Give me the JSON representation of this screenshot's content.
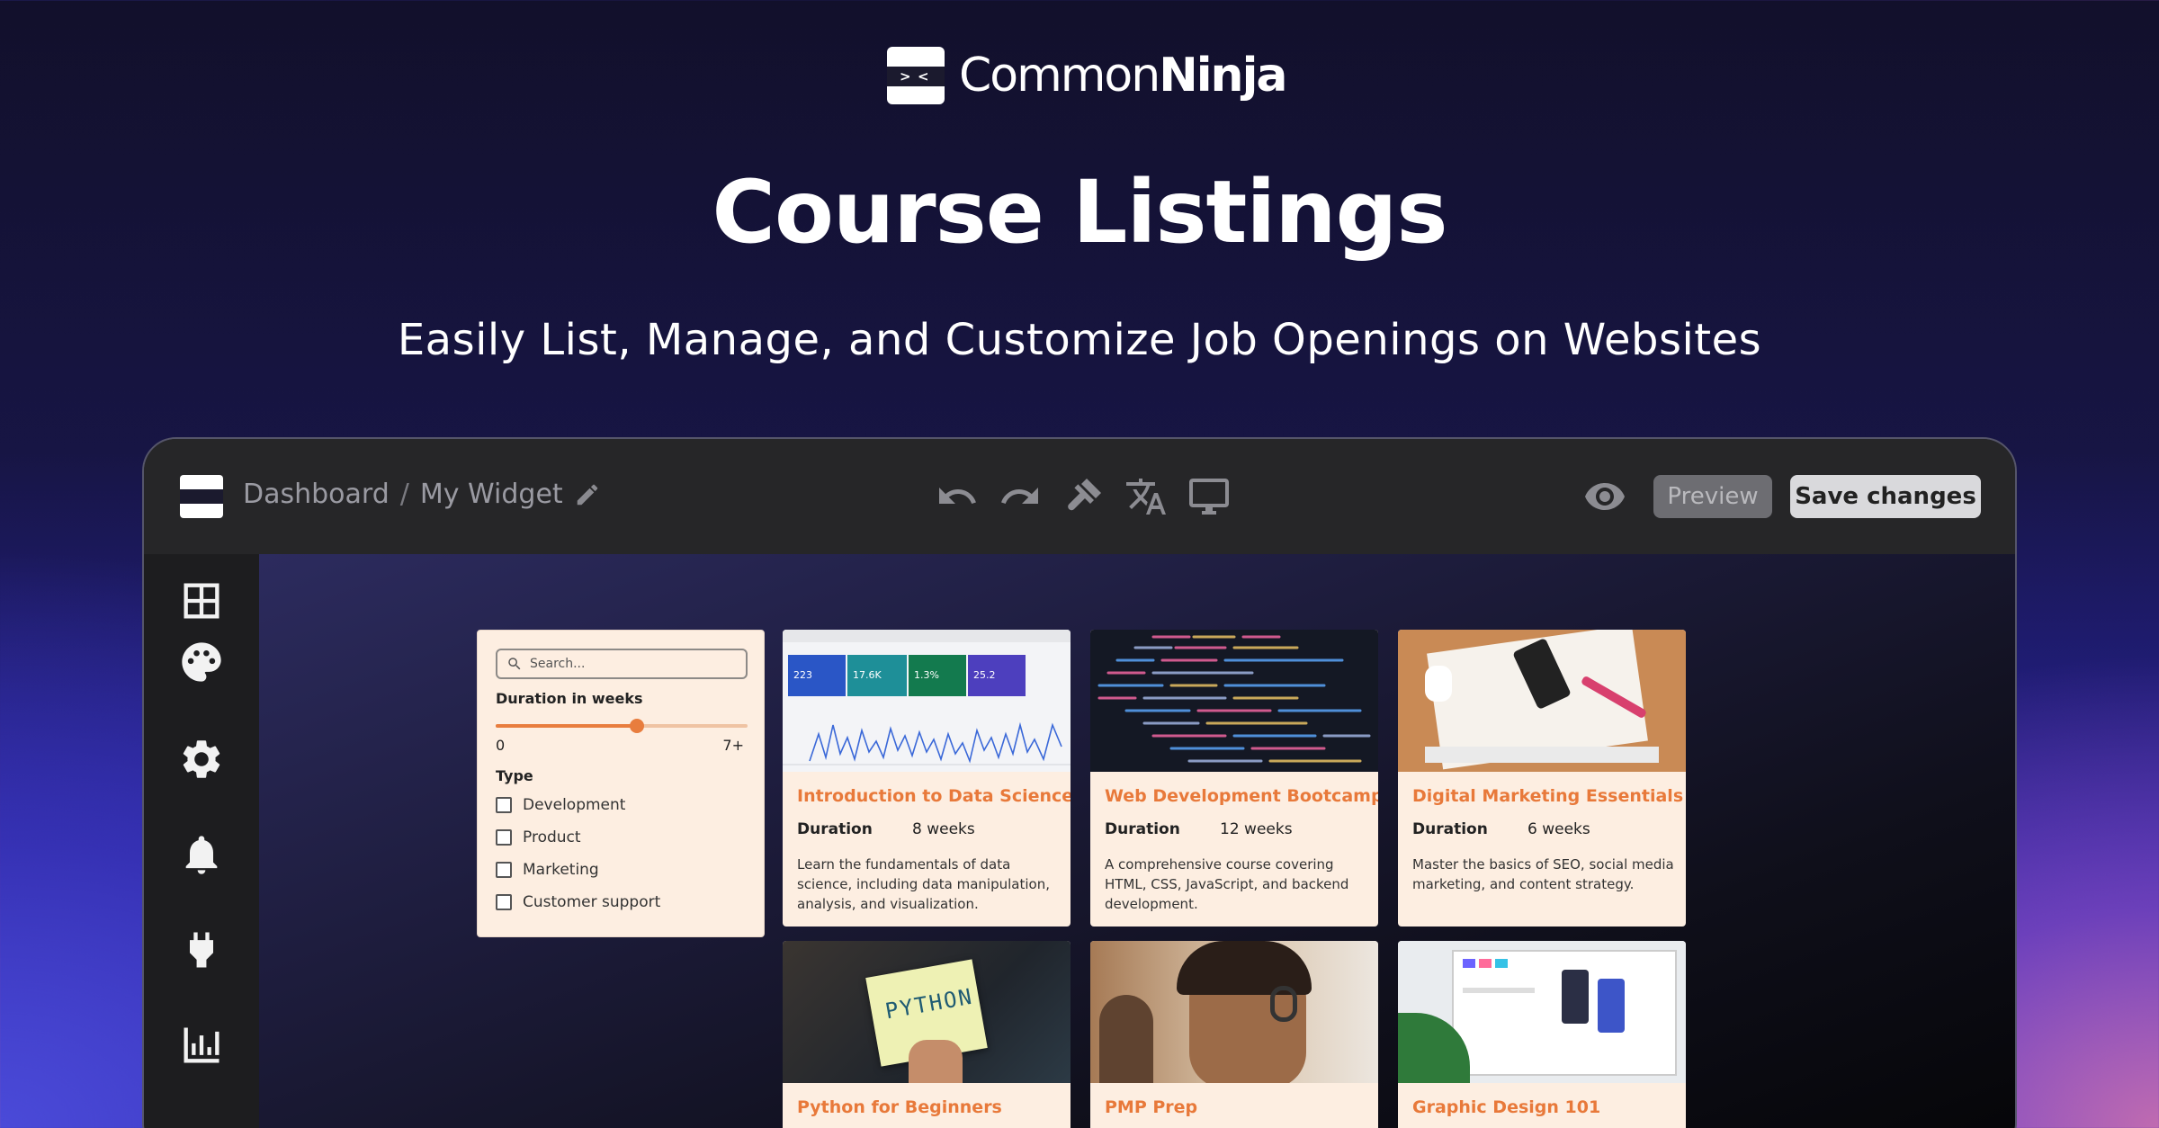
{
  "brand": {
    "name_light": "Common",
    "name_bold": "Ninja"
  },
  "hero": {
    "title": "Course Listings",
    "subtitle": "Easily List, Manage, and Customize Job Openings on Websites"
  },
  "toolbar": {
    "breadcrumb_root": "Dashboard",
    "breadcrumb_sep": "/",
    "breadcrumb_current": "My Widget",
    "preview_label": "Preview",
    "save_label": "Save changes",
    "icons": [
      "undo-icon",
      "redo-icon",
      "paint-brush-icon",
      "translate-icon",
      "desktop-icon",
      "eye-icon"
    ]
  },
  "sidebar": {
    "icons": [
      "layout-icon",
      "palette-icon",
      "settings-icon",
      "bell-icon",
      "plug-icon",
      "analytics-icon"
    ]
  },
  "filter": {
    "search_placeholder": "Search...",
    "duration_label": "Duration in weeks",
    "slider_min": "0",
    "slider_max": "7+",
    "slider_value_fraction": 0.56,
    "type_label": "Type",
    "types": [
      "Development",
      "Product",
      "Marketing",
      "Customer support"
    ]
  },
  "cards": [
    {
      "title": "Introduction to Data Science",
      "duration_label": "Duration",
      "duration_value": "8 weeks",
      "description": "Learn the fundamentals of data science, including data manipulation, analysis, and visualization.",
      "stats": [
        "223",
        "17.6K",
        "1.3%",
        "25.2"
      ]
    },
    {
      "title": "Web Development Bootcamp",
      "duration_label": "Duration",
      "duration_value": "12 weeks",
      "description": "A comprehensive course covering HTML, CSS, JavaScript, and backend development."
    },
    {
      "title": "Digital Marketing Essentials",
      "duration_label": "Duration",
      "duration_value": "6 weeks",
      "description": "Master the basics of SEO, social media marketing, and content strategy."
    },
    {
      "title": "Python for Beginners",
      "note_text": "PYTHON"
    },
    {
      "title": "PMP Prep"
    },
    {
      "title": "Graphic Design 101"
    }
  ],
  "colors": {
    "accent": "#e8793a",
    "card_bg": "#fdeee1",
    "toolbar_bg": "#262628",
    "sidebar_bg": "#1d1d1f"
  }
}
